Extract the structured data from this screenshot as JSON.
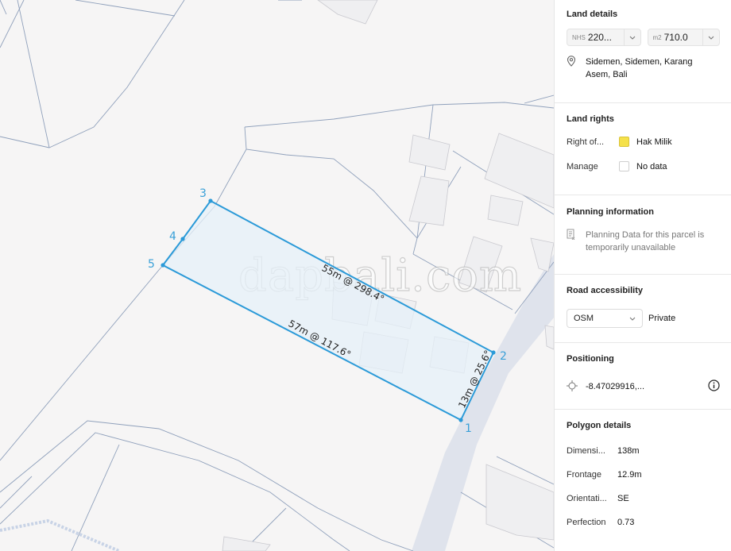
{
  "map": {
    "watermark": "dapbali.com",
    "vertex_labels": [
      "1",
      "2",
      "3",
      "4",
      "5"
    ],
    "segment_labels": {
      "top": "55m @ 298.4°",
      "bottom": "57m @ 117.6°",
      "right": "13m @ 25.6°"
    },
    "colors": {
      "polygon_stroke": "#2b9ad8",
      "polygon_fill": "#e6f0f8",
      "road": "#dfe3ec",
      "parcel_line": "#8fa0bb"
    }
  },
  "panel": {
    "land_details": {
      "title": "Land details",
      "nhs_unit": "NHS",
      "nhs_value": "220...",
      "area_unit": "m2",
      "area_value": "710.0",
      "location": "Sidemen, Sidemen, Karang Asem, Bali"
    },
    "land_rights": {
      "title": "Land rights",
      "right_label": "Right of...",
      "right_value": "Hak Milik",
      "right_color": "#f5e14a",
      "manage_label": "Manage",
      "manage_value": "No data"
    },
    "planning": {
      "title": "Planning information",
      "message": "Planning Data for this parcel is temporarily unavailable"
    },
    "road": {
      "title": "Road accessibility",
      "source": "OSM",
      "value": "Private"
    },
    "positioning": {
      "title": "Positioning",
      "coords": "-8.47029916,..."
    },
    "polygon": {
      "title": "Polygon details",
      "rows": [
        {
          "label": "Dimensi...",
          "value": "138m"
        },
        {
          "label": "Frontage",
          "value": "12.9m"
        },
        {
          "label": "Orientati...",
          "value": "SE"
        },
        {
          "label": "Perfection",
          "value": "0.73"
        }
      ]
    }
  }
}
